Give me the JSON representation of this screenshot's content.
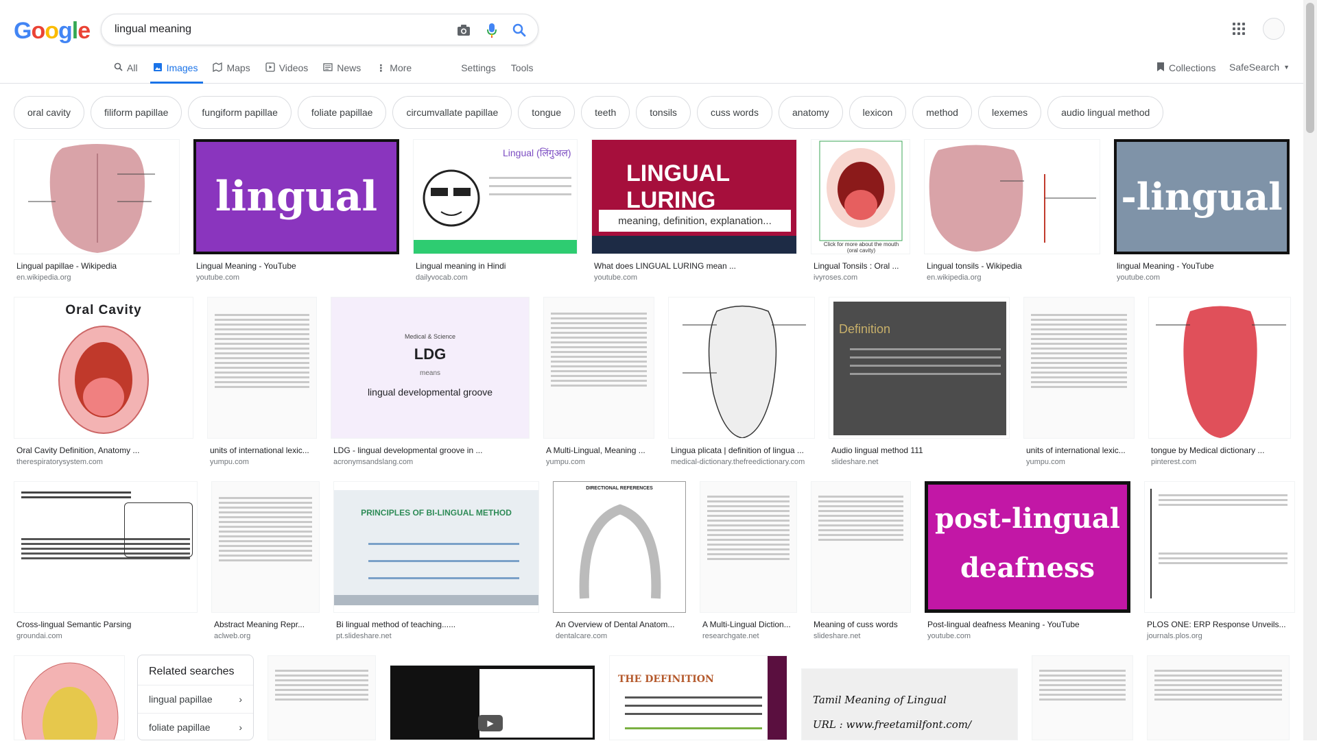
{
  "logo": {
    "letters": [
      "G",
      "o",
      "o",
      "g",
      "l",
      "e"
    ],
    "colors": [
      "#4285f4",
      "#ea4335",
      "#fbbc05",
      "#4285f4",
      "#34a853",
      "#ea4335"
    ]
  },
  "search": {
    "query": "lingual meaning"
  },
  "tabs": [
    {
      "label": "All",
      "icon": "search-icon"
    },
    {
      "label": "Images",
      "icon": "image-icon"
    },
    {
      "label": "Maps",
      "icon": "map-icon"
    },
    {
      "label": "Videos",
      "icon": "video-icon"
    },
    {
      "label": "News",
      "icon": "news-icon"
    },
    {
      "label": "More",
      "icon": "more-vert-icon"
    }
  ],
  "settings_label": "Settings",
  "tools_label": "Tools",
  "collections_label": "Collections",
  "safesearch_label": "SafeSearch",
  "chips": [
    "oral cavity",
    "filiform papillae",
    "fungiform papillae",
    "foliate papillae",
    "circumvallate papillae",
    "tongue",
    "teeth",
    "tonsils",
    "cuss words",
    "anatomy",
    "lexicon",
    "method",
    "lexemes",
    "audio lingual method"
  ],
  "row1": [
    {
      "caption": "Lingual papillae - Wikipedia",
      "source": "en.wikipedia.org"
    },
    {
      "caption": "Lingual Meaning - YouTube",
      "source": "youtube.com",
      "word": "lingual"
    },
    {
      "caption": "Lingual meaning in Hindi",
      "source": "dailyvocab.com",
      "title": "Lingual (लिंगुअल)"
    },
    {
      "caption": "What does LINGUAL LURING mean ...",
      "source": "youtube.com",
      "title": "LINGUAL LURING",
      "subtitle": "meaning, definition, explanation..."
    },
    {
      "caption": "Lingual Tonsils : Oral ...",
      "source": "ivyroses.com",
      "note": "Click for more about the mouth (oral cavity)"
    },
    {
      "caption": "Lingual tonsils - Wikipedia",
      "source": "en.wikipedia.org"
    },
    {
      "caption": "lingual Meaning - YouTube",
      "source": "youtube.com",
      "word": "-lingual"
    }
  ],
  "row2": [
    {
      "caption": "Oral Cavity Definition, Anatomy ...",
      "source": "therespiratorysystem.com",
      "title": "Oral Cavity"
    },
    {
      "caption": "units of international lexic...",
      "source": "yumpu.com"
    },
    {
      "caption": "LDG - lingual developmental groove in ...",
      "source": "acronymsandslang.com",
      "label": "Medical & Science",
      "abbr": "LDG",
      "means": "means",
      "full": "lingual developmental groove"
    },
    {
      "caption": "A Multi-Lingual, Meaning ...",
      "source": "yumpu.com"
    },
    {
      "caption": "Lingua plicata | definition of lingua ...",
      "source": "medical-dictionary.thefreedictionary.com"
    },
    {
      "caption": "Audio lingual method 111",
      "source": "slideshare.net",
      "title": "Definition"
    },
    {
      "caption": "units of international lexic...",
      "source": "yumpu.com"
    },
    {
      "caption": "tongue by Medical dictionary ...",
      "source": "pinterest.com"
    }
  ],
  "row3": [
    {
      "caption": "Cross-lingual Semantic Parsing",
      "source": "groundai.com"
    },
    {
      "caption": "Abstract Meaning Repr...",
      "source": "aclweb.org"
    },
    {
      "caption": "Bi lingual method of teaching......",
      "source": "pt.slideshare.net",
      "title": "PRINCIPLES OF BI-LINGUAL METHOD"
    },
    {
      "caption": "An Overview of Dental Anatom...",
      "source": "dentalcare.com",
      "title": "DIRECTIONAL REFERENCES"
    },
    {
      "caption": "A Multi-Lingual Diction...",
      "source": "researchgate.net"
    },
    {
      "caption": "Meaning of cuss words",
      "source": "slideshare.net"
    },
    {
      "caption": "Post-lingual deafness Meaning - YouTube",
      "source": "youtube.com",
      "word1": "post-lingual",
      "word2": "deafness"
    },
    {
      "caption": "PLOS ONE: ERP Response Unveils...",
      "source": "journals.plos.org"
    }
  ],
  "related": {
    "title": "Related searches",
    "items": [
      "lingual papillae",
      "foliate papillae"
    ]
  },
  "row4": {
    "definition_title": "THE DEFINITION",
    "tamil_line1": "Tamil Meaning of Lingual",
    "tamil_line2": "URL : www.freetamilfont.com/"
  }
}
